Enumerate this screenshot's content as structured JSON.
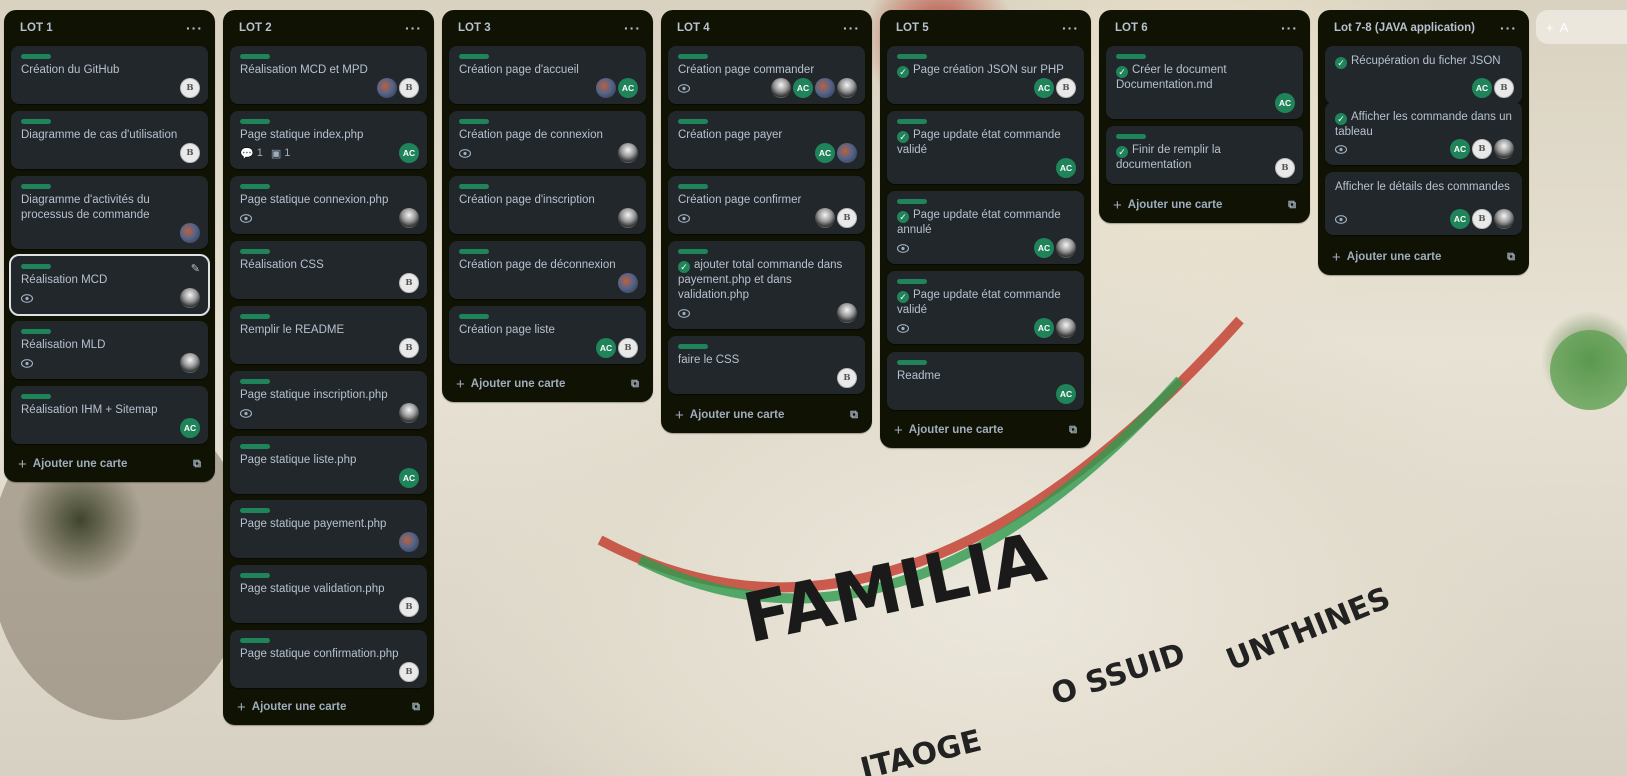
{
  "lists": [
    {
      "title": "LOT 1",
      "add_label": "Ajouter une carte",
      "cards": [
        {
          "title": "Création du GitHub"
        },
        {
          "title": "Diagramme de cas d'utilisation"
        },
        {
          "title": "Diagramme d'activités du processus de commande"
        },
        {
          "title": "Réalisation MCD"
        },
        {
          "title": "Réalisation MLD"
        },
        {
          "title": "Réalisation IHM + Sitemap",
          "member": "AC"
        }
      ]
    },
    {
      "title": "LOT 2",
      "add_label": "Ajouter une carte",
      "cards": [
        {
          "title": "Réalisation MCD et MPD"
        },
        {
          "title": "Page statique index.php",
          "comments": "1",
          "attachments": "1",
          "member": "AC"
        },
        {
          "title": "Page statique connexion.php"
        },
        {
          "title": "Réalisation CSS"
        },
        {
          "title": "Remplir le README"
        },
        {
          "title": "Page statique inscription.php"
        },
        {
          "title": "Page statique liste.php",
          "member": "AC"
        },
        {
          "title": "Page statique payement.php"
        },
        {
          "title": "Page statique validation.php"
        },
        {
          "title": "Page statique confirmation.php"
        }
      ]
    },
    {
      "title": "LOT 3",
      "add_label": "Ajouter une carte",
      "cards": [
        {
          "title": "Création page d'accueil",
          "member": "AC"
        },
        {
          "title": "Création page de connexion"
        },
        {
          "title": "Création page d'inscription"
        },
        {
          "title": "Création page de déconnexion"
        },
        {
          "title": "Création page liste",
          "member": "AC"
        }
      ]
    },
    {
      "title": "LOT 4",
      "add_label": "Ajouter une carte",
      "cards": [
        {
          "title": "Création page commander",
          "member": "AC"
        },
        {
          "title": "Création page payer",
          "member": "AC"
        },
        {
          "title": "Création page confirmer"
        },
        {
          "title": "ajouter total commande dans payement.php et dans validation.php"
        },
        {
          "title": "faire le CSS"
        }
      ]
    },
    {
      "title": "LOT 5",
      "add_label": "Ajouter une carte",
      "cards": [
        {
          "title": "Page création JSON sur PHP",
          "member": "AC"
        },
        {
          "title": "Page update état commande validé",
          "member": "AC"
        },
        {
          "title": "Page update état commande annulé",
          "member": "AC"
        },
        {
          "title": "Page update état commande validé",
          "member": "AC"
        },
        {
          "title": "Readme",
          "member": "AC"
        }
      ]
    },
    {
      "title": "LOT 6",
      "add_label": "Ajouter une carte",
      "cards": [
        {
          "title": "Créer le document Documentation.md",
          "member": "AC"
        },
        {
          "title": "Finir de remplir la documentation"
        }
      ]
    },
    {
      "title": "Lot 7-8 (JAVA application)",
      "add_label": "Ajouter une carte",
      "cards": [
        {
          "title": "Récupération du ficher JSON",
          "member": "AC"
        },
        {
          "title": "Afficher les commande dans un tableau",
          "member": "AC"
        },
        {
          "title": "Afficher le détails des commandes",
          "member": "AC"
        }
      ]
    }
  ],
  "add_list_label": "A",
  "list_menu": "···",
  "lb_initials": "B"
}
